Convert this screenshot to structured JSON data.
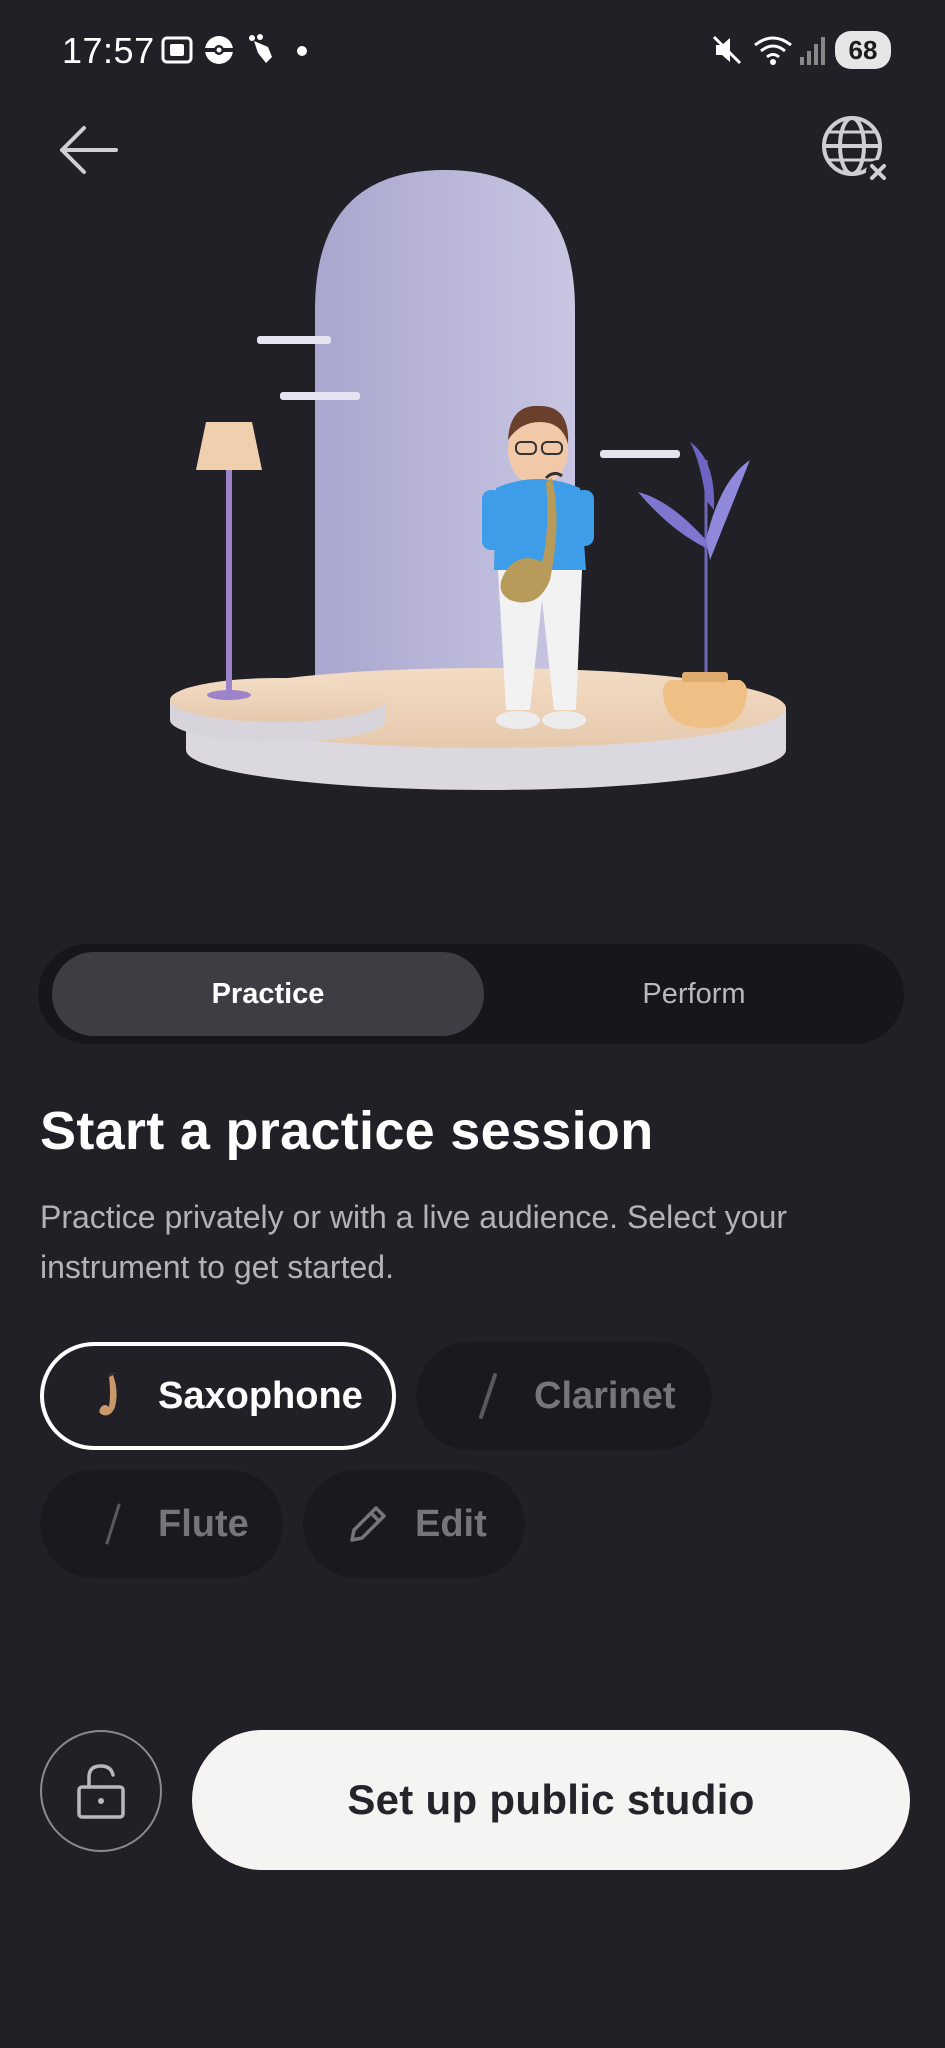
{
  "status_bar": {
    "time": "17:57",
    "battery": "68"
  },
  "nav": {
    "back_icon": "arrow-left-icon",
    "globe_icon": "globe-off-icon"
  },
  "tabs": [
    {
      "label": "Practice",
      "selected": true
    },
    {
      "label": "Perform",
      "selected": false
    }
  ],
  "heading": "Start a practice session",
  "description": "Practice privately or with a live audience. Select your instrument to get started.",
  "instruments": [
    {
      "label": "Saxophone",
      "icon": "saxophone-icon",
      "selected": true
    },
    {
      "label": "Clarinet",
      "icon": "clarinet-icon",
      "selected": false
    },
    {
      "label": "Flute",
      "icon": "flute-icon",
      "selected": false
    },
    {
      "label": "Edit",
      "icon": "pencil-icon",
      "selected": false
    }
  ],
  "bottom": {
    "lock_icon": "unlock-icon",
    "cta_label": "Set up public studio"
  },
  "colors": {
    "background": "#212027",
    "segment_bg": "#17161b",
    "segment_selected": "#3e3d43",
    "chip_bg": "#1a191e",
    "cta_bg": "#f5f4f2"
  }
}
